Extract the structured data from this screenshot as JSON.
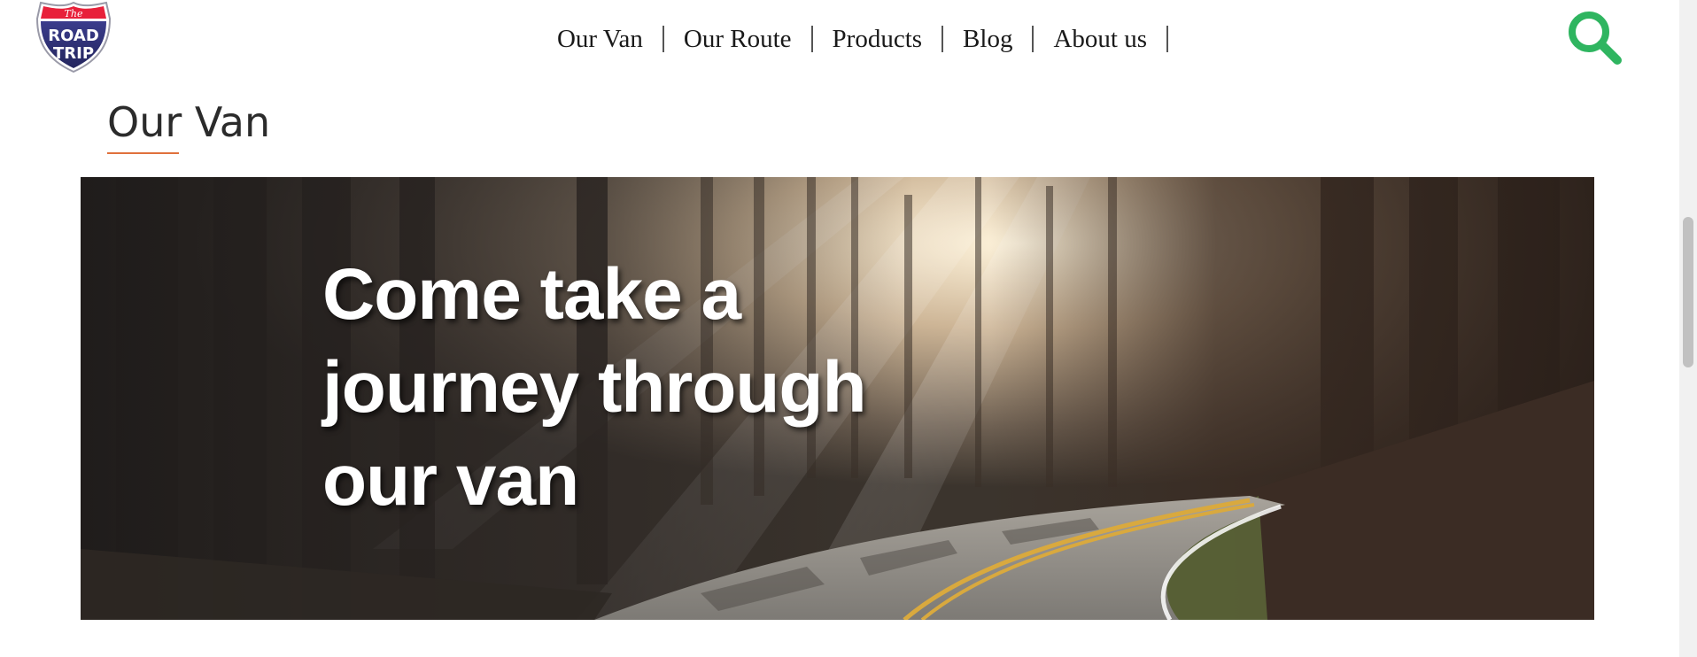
{
  "header": {
    "logo": {
      "small_text": "The",
      "line1": "ROAD",
      "line2": "TRIP"
    },
    "nav": [
      {
        "label": "Our Van"
      },
      {
        "label": "Our Route"
      },
      {
        "label": "Products"
      },
      {
        "label": "Blog"
      },
      {
        "label": "About us"
      }
    ],
    "search_icon": "search-icon"
  },
  "section": {
    "title": "Our Van"
  },
  "hero": {
    "line1": "Come take a",
    "line2": "journey through",
    "line3": "our van"
  },
  "colors": {
    "search_accent": "#2fb560",
    "title_underline": "#e0713c",
    "logo_red": "#e8203a",
    "logo_navy": "#2c2f7a"
  }
}
